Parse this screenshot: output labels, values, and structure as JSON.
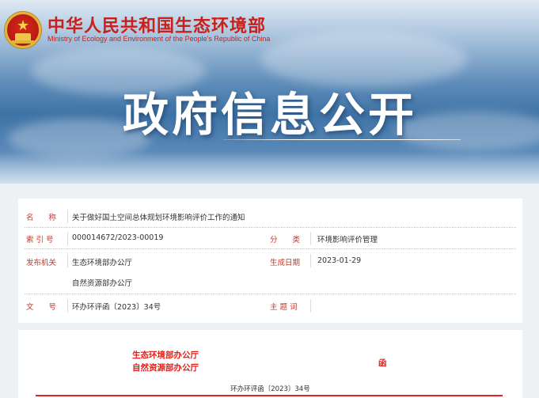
{
  "header": {
    "ministry_cn": "中华人民共和国生态环境部",
    "ministry_en": "Ministry of Ecology and Environment of the People's Republic of China",
    "banner_title": "政府信息公开"
  },
  "info": {
    "name_label": "名　　称",
    "name_value": "关于做好国土空间总体规划环境影响评价工作的通知",
    "index_label": "索 引 号",
    "index_value": "000014672/2023-00019",
    "category_label": "分　　类",
    "category_value": "环境影响评价管理",
    "issuer_label": "发布机关",
    "issuer_values": [
      "生态环境部办公厅",
      "自然资源部办公厅"
    ],
    "date_label": "生成日期",
    "date_value": "2023-01-29",
    "docno_label": "文　　号",
    "docno_value": "环办环评函〔2023〕34号",
    "keywords_label": "主 题 词",
    "keywords_value": ""
  },
  "document": {
    "issuer_line1": "生态环境部办公厅",
    "issuer_line2": "自然资源部办公厅",
    "doc_type": "函",
    "doc_number": "环办环评函〔2023〕34号"
  },
  "colors": {
    "accent_red": "#c8201a",
    "label_red": "#c0392b",
    "doc_red": "#e0221a"
  }
}
